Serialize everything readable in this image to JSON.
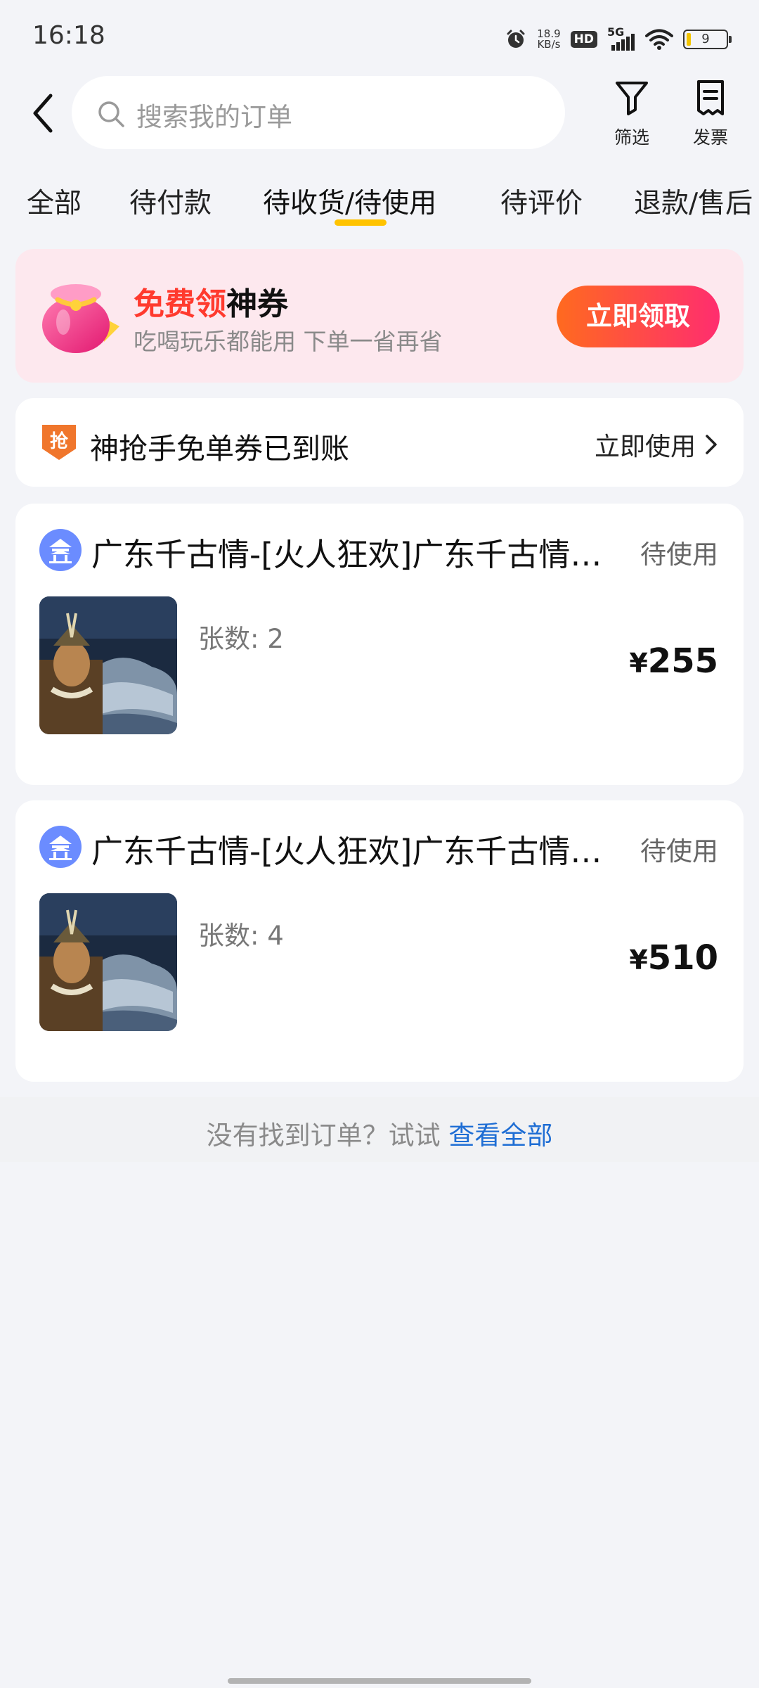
{
  "status_bar": {
    "time": "16:18",
    "net_speed_value": "18.9",
    "net_speed_unit": "KB/s",
    "hd_label": "HD",
    "network_label": "5G",
    "battery_level": "9",
    "icons": [
      "alarm-icon",
      "wifi-icon",
      "battery-icon"
    ]
  },
  "header": {
    "search_placeholder": "搜索我的订单",
    "filter_label": "筛选",
    "invoice_label": "发票"
  },
  "tabs": [
    {
      "label": "全部"
    },
    {
      "label": "待付款"
    },
    {
      "label": "待收货/待使用"
    },
    {
      "label": "待评价"
    },
    {
      "label": "退款/售后"
    }
  ],
  "active_tab_index": 2,
  "promo": {
    "title_highlight": "免费领",
    "title_rest": "神券",
    "subtitle": "吃喝玩乐都能用 下单一省再省",
    "button": "立即领取",
    "colors": {
      "highlight": "#ff3a2e",
      "button_start": "#ff6a1f",
      "button_end": "#ff2d6f"
    }
  },
  "coupon": {
    "icon_text": "抢",
    "text": "神抢手免单券已到账",
    "action": "立即使用"
  },
  "orders": [
    {
      "title": "广东千古情-[火人狂欢]广东千古情…",
      "status": "待使用",
      "qty_label": "张数: 2",
      "currency": "¥",
      "price": "255"
    },
    {
      "title": "广东千古情-[火人狂欢]广东千古情…",
      "status": "待使用",
      "qty_label": "张数: 4",
      "currency": "¥",
      "price": "510"
    }
  ],
  "footer": {
    "hint_text": "没有找到订单？试试 ",
    "hint_link": "查看全部"
  }
}
